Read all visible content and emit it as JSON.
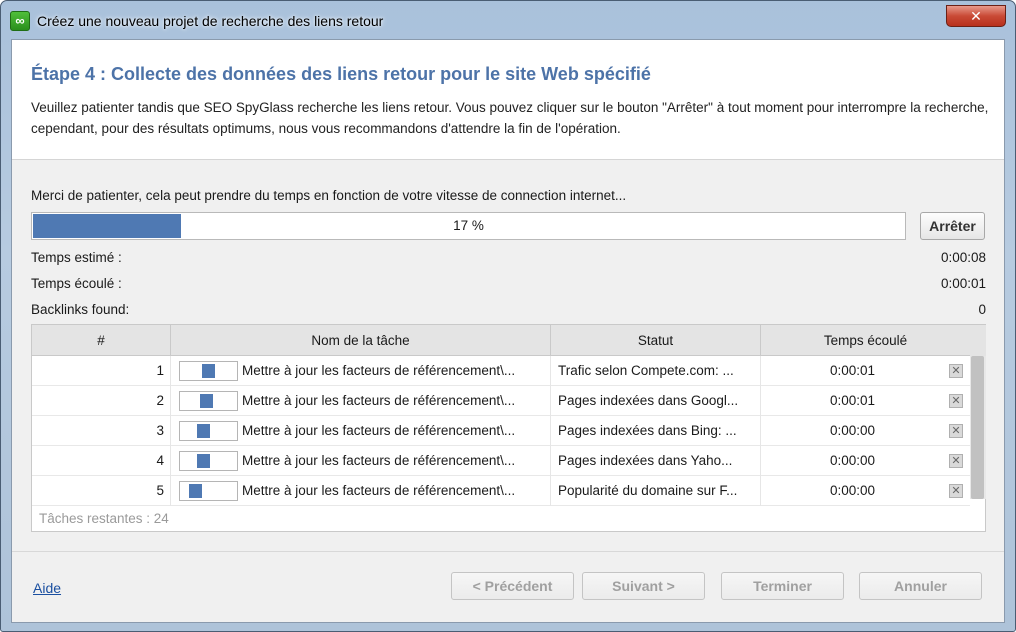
{
  "window": {
    "title": "Créez une nouveau projet de recherche des liens retour",
    "app_icon": "link-icon",
    "close_glyph": "✕"
  },
  "header": {
    "step_title": "Étape 4 :  Collecte des données des liens retour pour le site Web spécifié",
    "description": "Veuillez patienter tandis que SEO SpyGlass recherche les liens retour. Vous pouvez cliquer sur le bouton \"Arrêter\" à tout moment pour interrompre la recherche, cependant, pour des résultats optimums, nous vous recommandons d'attendre la fin de l'opération."
  },
  "progress": {
    "message": "Merci de patienter, cela peut prendre du temps en fonction de votre vitesse de connection internet...",
    "percent": 17,
    "label": "17 %",
    "stop_label": "Arrêter",
    "accent_color": "#4f79b3"
  },
  "info": {
    "estimated_label": "Temps estimé :",
    "estimated_value": "0:00:08",
    "elapsed_label": "Temps écoulé :",
    "elapsed_value": "0:00:01",
    "backlinks_label": "Backlinks found:",
    "backlinks_value": "0"
  },
  "table": {
    "columns": [
      "#",
      "Nom de la tâche",
      "Statut",
      "Temps écoulé"
    ],
    "rows": [
      {
        "num": "1",
        "task": "Mettre à jour les facteurs de référencement\\...",
        "status": "Trafic selon Compete.com: ...",
        "time": "0:00:01",
        "progress": 0.45
      },
      {
        "num": "2",
        "task": "Mettre à jour les facteurs de référencement\\...",
        "status": "Pages indexées dans Googl...",
        "time": "0:00:01",
        "progress": 0.4
      },
      {
        "num": "3",
        "task": "Mettre à jour les facteurs de référencement\\...",
        "status": "Pages indexées dans Bing: ...",
        "time": "0:00:00",
        "progress": 0.35
      },
      {
        "num": "4",
        "task": "Mettre à jour les facteurs de référencement\\...",
        "status": "Pages indexées dans Yaho...",
        "time": "0:00:00",
        "progress": 0.35
      },
      {
        "num": "5",
        "task": "Mettre à jour les facteurs de référencement\\...",
        "status": "Popularité du domaine sur F...",
        "time": "0:00:00",
        "progress": 0.15
      }
    ],
    "remove_glyph": "✕",
    "remaining": "Tâches restantes : 24"
  },
  "footer": {
    "help": "Aide",
    "previous": "< Précédent",
    "next": "Suivant >",
    "finish": "Terminer",
    "cancel": "Annuler"
  }
}
